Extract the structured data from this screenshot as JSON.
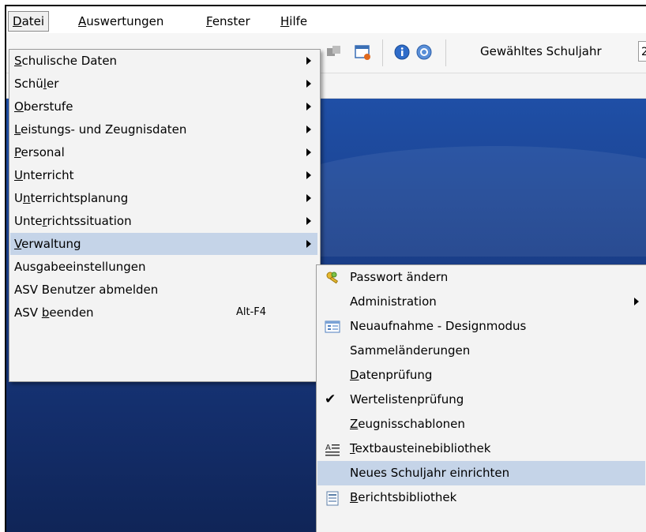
{
  "menubar": {
    "items": [
      {
        "pre": "",
        "key": "D",
        "post": "atei"
      },
      {
        "pre": "",
        "key": "A",
        "post": "uswertungen"
      },
      {
        "pre": "",
        "key": "F",
        "post": "enster"
      },
      {
        "pre": "",
        "key": "H",
        "post": "ilfe"
      }
    ]
  },
  "toolbar": {
    "year_label": "Gewähltes Schuljahr",
    "year_value": "2"
  },
  "menu_datei": {
    "items": [
      {
        "pre": "",
        "key": "S",
        "post": "chulische Daten"
      },
      {
        "pre": "Schü",
        "key": "l",
        "post": "er"
      },
      {
        "pre": "",
        "key": "O",
        "post": "berstufe"
      },
      {
        "pre": "",
        "key": "L",
        "post": "eistungs- und Zeugnisdaten"
      },
      {
        "pre": "",
        "key": "P",
        "post": "ersonal"
      },
      {
        "pre": "",
        "key": "U",
        "post": "nterricht"
      },
      {
        "pre": "U",
        "key": "n",
        "post": "terrichtsplanung"
      },
      {
        "pre": "Unte",
        "key": "r",
        "post": "richtssituation"
      },
      {
        "pre": "",
        "key": "V",
        "post": "erwaltung"
      },
      {
        "pre": "Ausgabeeinstellungen",
        "key": "",
        "post": ""
      },
      {
        "pre": "ASV Benutzer abmelden",
        "key": "",
        "post": ""
      },
      {
        "pre": "ASV ",
        "key": "b",
        "post": "eenden",
        "shortcut": "Alt-F4"
      }
    ]
  },
  "menu_verwaltung": {
    "items": [
      {
        "pre": "Passwort ändern",
        "key": "",
        "post": ""
      },
      {
        "pre": "Administration",
        "key": "",
        "post": ""
      },
      {
        "pre": "Neuaufnahme - Designmodus",
        "key": "",
        "post": ""
      },
      {
        "pre": "Sammeländerungen",
        "key": "",
        "post": ""
      },
      {
        "pre": "",
        "key": "D",
        "post": "atenprüfung"
      },
      {
        "pre": "Wertelistenprüfung",
        "key": "",
        "post": ""
      },
      {
        "pre": "",
        "key": "Z",
        "post": "eugnisschablonen"
      },
      {
        "pre": "",
        "key": "T",
        "post": "extbausteinebibliothek"
      },
      {
        "pre": "Neues Schuljahr einrichten",
        "key": "",
        "post": ""
      },
      {
        "pre": "",
        "key": "B",
        "post": "erichtsbibliothek"
      }
    ]
  },
  "icons": {
    "passwort": "keys-icon",
    "neuaufnahme": "form-icon",
    "wertelisten": "checkmark-icon",
    "textbausteine": "text-lines-icon",
    "berichte": "report-icon"
  }
}
